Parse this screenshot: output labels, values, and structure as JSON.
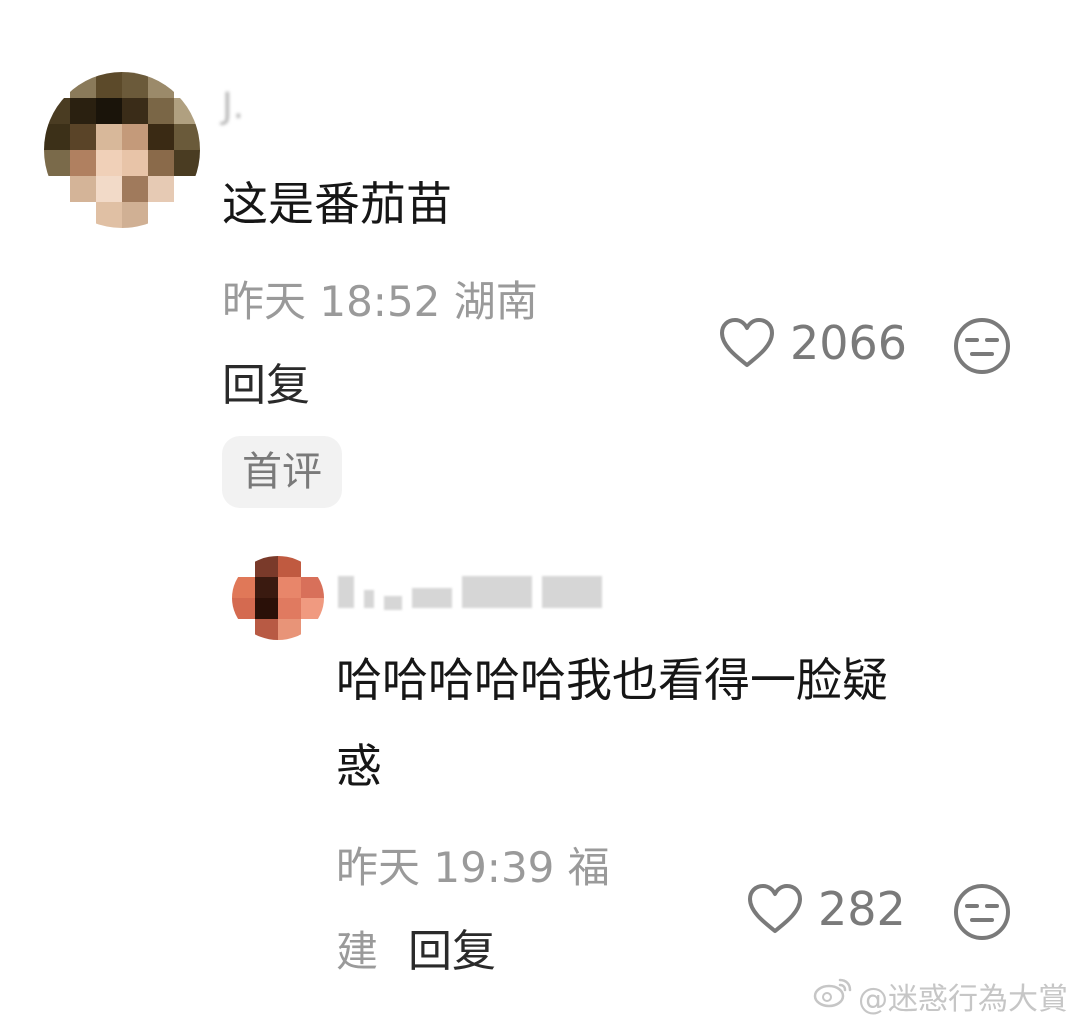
{
  "comment": {
    "username": "J.",
    "text": "这是番茄苗",
    "meta": "昨天 18:52 湖南",
    "reply_label": "回复",
    "badge": "首评",
    "likes": "2066",
    "like_icon": "heart-outline-icon",
    "dislike_icon": "meh-face-icon"
  },
  "reply": {
    "text_line1": "哈哈哈哈哈我也看得一脸疑",
    "text_line2": "惑",
    "meta_line1": "昨天 19:39 福",
    "meta_line2": "建",
    "reply_label": "回复",
    "likes": "282",
    "like_icon": "heart-outline-icon",
    "dislike_icon": "meh-face-icon"
  },
  "watermark": {
    "text": "@迷惑行為大賞",
    "icon": "weibo-icon"
  },
  "colors": {
    "text_primary": "#161616",
    "text_meta": "#9a9a9a",
    "icon_gray": "#7a7a7a",
    "tag_bg": "#f2f2f2"
  }
}
